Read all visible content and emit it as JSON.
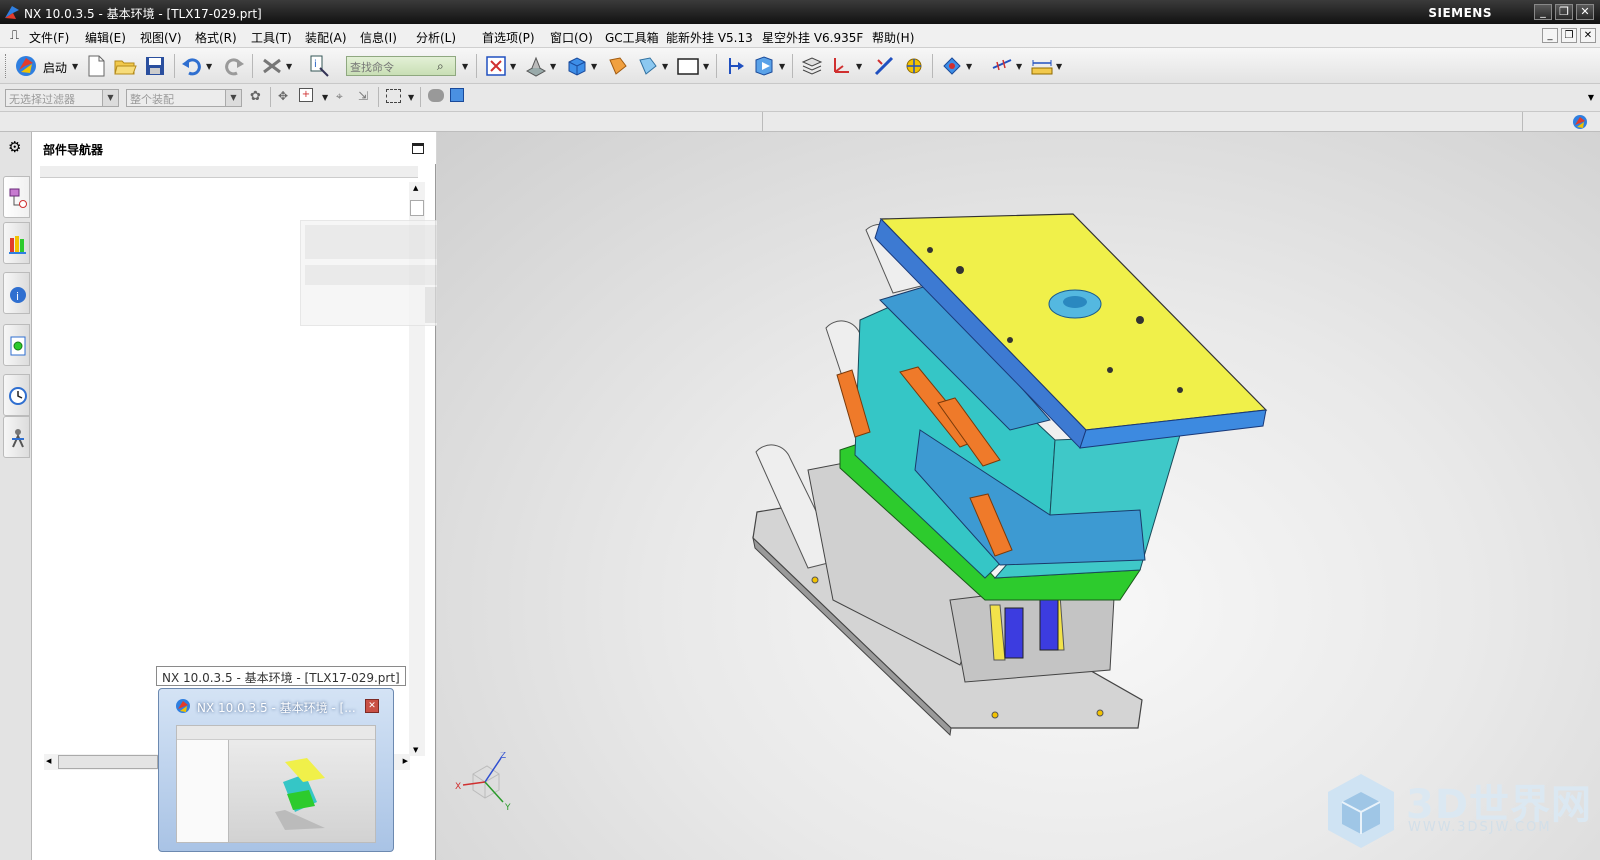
{
  "window": {
    "title": "NX 10.0.3.5 - 基本环境 - [TLX17-029.prt]",
    "brand": "SIEMENS",
    "controls": [
      "minimize-icon",
      "restore-icon",
      "close-icon"
    ]
  },
  "menubar": {
    "items": [
      "文件(F)",
      "编辑(E)",
      "视图(V)",
      "格式(R)",
      "工具(T)",
      "装配(A)",
      "信息(I)",
      "分析(L)",
      "首选项(P)",
      "窗口(O)",
      "GC工具箱",
      "能新外挂 V5.13",
      "星空外挂 V6.935F",
      "帮助(H)"
    ]
  },
  "toolbar": {
    "start_label": "启动",
    "search_placeholder": "查找命令"
  },
  "selection_bar": {
    "filter_value": "无选择过滤器",
    "scope_value": "整个装配"
  },
  "navigator": {
    "title": "部件导航器"
  },
  "taskbar_preview": {
    "tooltip": "NX 10.0.3.5 - 基本环境 - [TLX17-029.prt]",
    "title": "NX 10.0.3.5 - 基本环境 - [..."
  },
  "viewport": {
    "axes": {
      "x": "X",
      "y": "Y",
      "z": "Z"
    },
    "colors": {
      "top_plate": "#f0f04a",
      "a_plate": "#35c6c6",
      "b_plate": "#3d9ad2",
      "green_plate": "#2dcb2d",
      "lifter_blocks": "#ef7a2a",
      "springs": "#3c3ce0",
      "gray_plates": "#d4d4d4"
    }
  },
  "watermark": {
    "main": "3D世界网",
    "sub": "WWW.3DSJW.COM"
  }
}
